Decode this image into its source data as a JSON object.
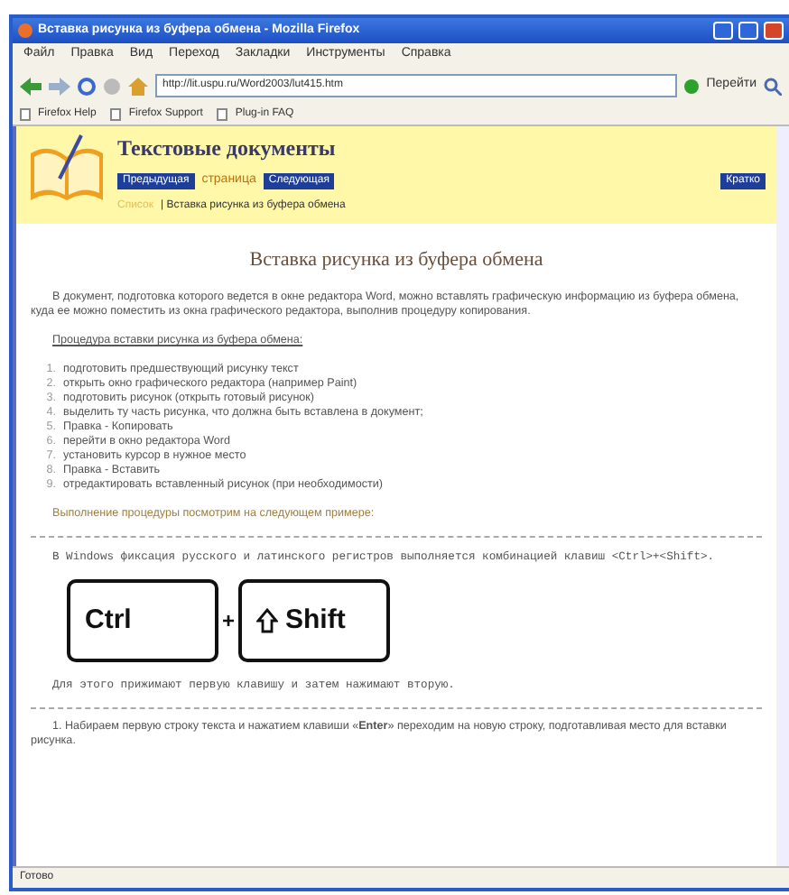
{
  "window": {
    "title": "Вставка рисунка из буфера обмена - Mozilla Firefox"
  },
  "menu": [
    "Файл",
    "Правка",
    "Вид",
    "Переход",
    "Закладки",
    "Инструменты",
    "Справка"
  ],
  "toolbar": {
    "address": "http://lit.uspu.ru/Word2003/lut415.htm",
    "go_label": "Перейти"
  },
  "bookmarks": [
    "Firefox Help",
    "Firefox Support",
    "Plug-in FAQ"
  ],
  "site": {
    "title": "Текстовые документы",
    "nav": [
      {
        "label": "Предыдущая",
        "kind": "button"
      },
      {
        "label": "страница",
        "kind": "text"
      },
      {
        "label": "Следующая",
        "kind": "button"
      }
    ],
    "summary_button": "Кратко",
    "breadcrumb": [
      {
        "text": "Список",
        "kind": "link"
      },
      {
        "text": "| Вставка рисунка из буфера обмена",
        "kind": "text"
      }
    ]
  },
  "article": {
    "heading": "Вставка рисунка из буфера обмена",
    "intro": "В документ, подготовка которого ведется в окне редактора Word, можно вставлять графическую информацию из буфера обмена, куда ее можно поместить из окна графического редактора, выполнив процедуру копирования.",
    "procedure_title": "Процедура вставки рисунка из буфера обмена:",
    "steps": [
      {
        "number": "1.",
        "text": "подготовить предшествующий рисунку текст"
      },
      {
        "number": "2.",
        "text": "открыть окно графического редактора (например Paint)"
      },
      {
        "number": "3.",
        "text": "подготовить рисунок (открыть готовый рисунок)"
      },
      {
        "number": "4.",
        "text": "выделить ту часть рисунка, что должна быть вставлена в документ;"
      },
      {
        "number": "5.",
        "text": "Правка - Копировать"
      },
      {
        "number": "6.",
        "text": "перейти в окно редактора Word"
      },
      {
        "number": "7.",
        "text": "установить курсор в нужное место"
      },
      {
        "number": "8.",
        "text": "Правка - Вставить"
      },
      {
        "number": "9.",
        "text": "отредактировать вставленный рисунок (при необходимости)"
      }
    ],
    "example_note": "Выполнение процедуры посмотрим на следующем примере:",
    "example_text": "В Windows фиксация русского и латинского регистров выполняется комбинацией клавиш <Ctrl>+<Shift>.",
    "keys": [
      {
        "label": "Ctrl",
        "kind": "plain"
      },
      {
        "label": "Shift",
        "kind": "shift"
      }
    ],
    "key_joiner": "+",
    "example_after": "Для этого прижимают первую клавишу и затем нажимают вторую.",
    "step_text": "1. Набираем первую строку текста и нажатием клавиши «**Enter**» переходим на новую строку, подготавливая место для вставки рисунка."
  },
  "status_bar": "Готово"
}
